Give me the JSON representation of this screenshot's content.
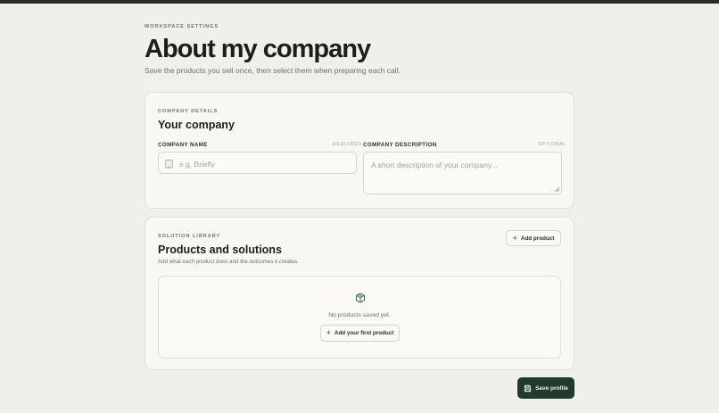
{
  "header": {
    "eyebrow": "WORKSPACE SETTINGS",
    "title": "About my company",
    "subtitle": "Save the products you sell once, then select them when preparing each call."
  },
  "company_card": {
    "eyebrow": "COMPANY DETAILS",
    "title": "Your company",
    "name_field": {
      "label": "COMPANY NAME",
      "tag": "REQUIRED",
      "placeholder": "e.g. Briefly",
      "value": "",
      "icon": "building-icon"
    },
    "description_field": {
      "label": "COMPANY DESCRIPTION",
      "tag": "OPTIONAL",
      "placeholder": "A short description of your company...",
      "value": ""
    }
  },
  "products_card": {
    "eyebrow": "SOLUTION LIBRARY",
    "title": "Products and solutions",
    "subtitle": "Add what each product does and the outcomes it creates.",
    "add_button": "Add product",
    "empty": {
      "icon": "package-icon",
      "message": "No products saved yet.",
      "button": "Add your first product"
    }
  },
  "footer": {
    "save_button": "Save profile",
    "save_icon": "save-icon"
  },
  "colors": {
    "background": "#f1efe9",
    "card": "#f8f7f3",
    "accent": "#1f3a2e",
    "icon_green": "#3e6b55"
  }
}
